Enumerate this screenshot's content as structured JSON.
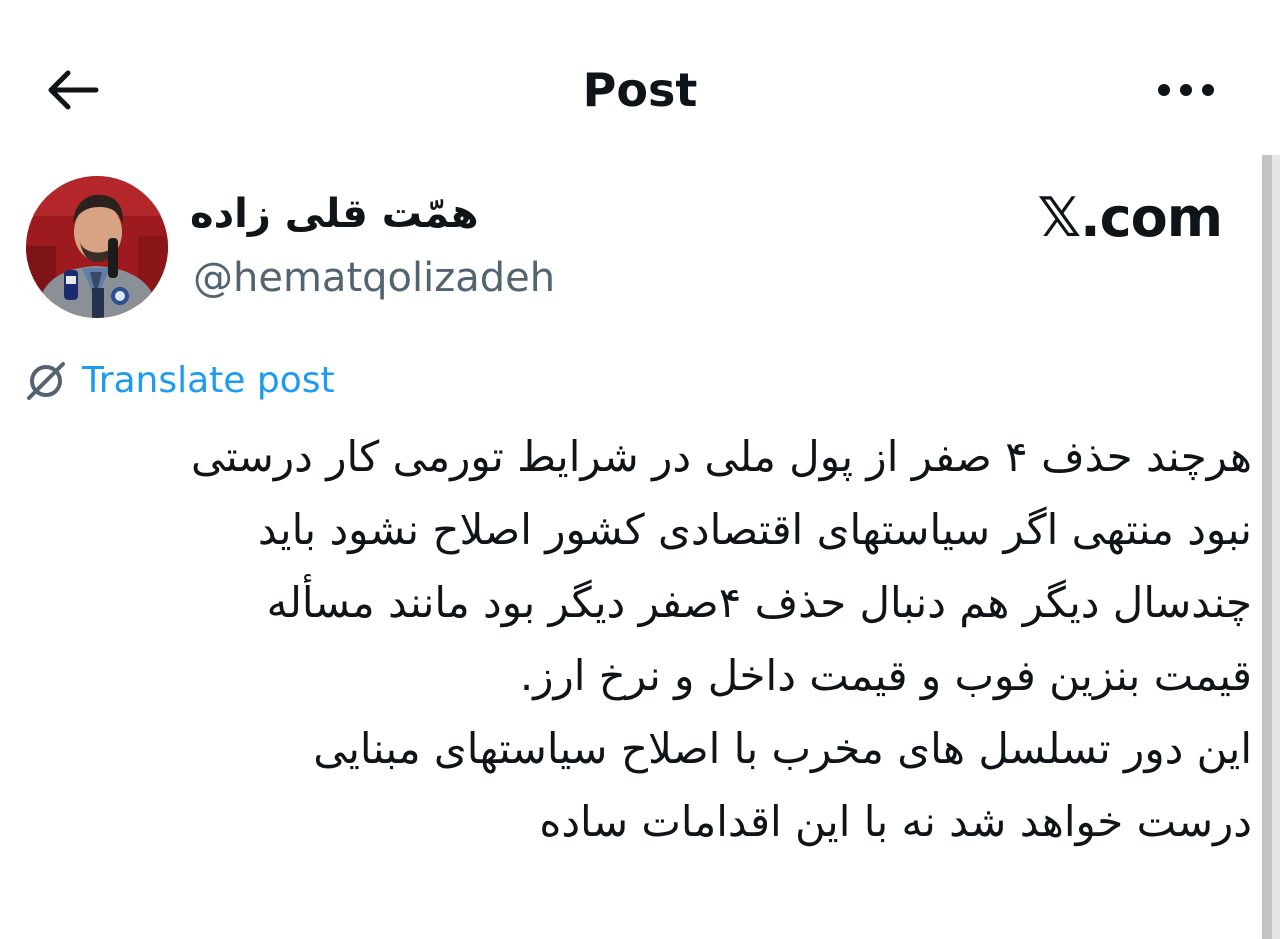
{
  "header": {
    "title": "Post",
    "back_icon": "arrow-left-icon",
    "more_icon": "more-horizontal-icon"
  },
  "author": {
    "name": "همّت قلی زاده",
    "handle": "@hematqolizadeh",
    "avatar": "avatar-photo"
  },
  "watermark": "𝕏.com",
  "translate": {
    "label": "Translate post",
    "icon": "translate-globe-icon"
  },
  "post": {
    "lines": [
      "هرچند حذف ۴ صفر از پول ملی در شرایط تورمی کار درستی",
      "نبود منتهی اگر سیاستهای اقتصادی کشور اصلاح نشود باید",
      "چندسال دیگر هم دنبال حذف ۴صفر دیگر بود مانند مسأله",
      "قیمت بنزین فوب و قیمت داخل و نرخ ارز.",
      "این دور تسلسل های مخرب با اصلاح سیاستهای مبنایی",
      "درست خواهد شد نه با این اقدامات ساده"
    ]
  },
  "colors": {
    "text": "#0f1419",
    "secondary": "#536471",
    "link": "#1d9bf0",
    "background": "#ffffff"
  }
}
